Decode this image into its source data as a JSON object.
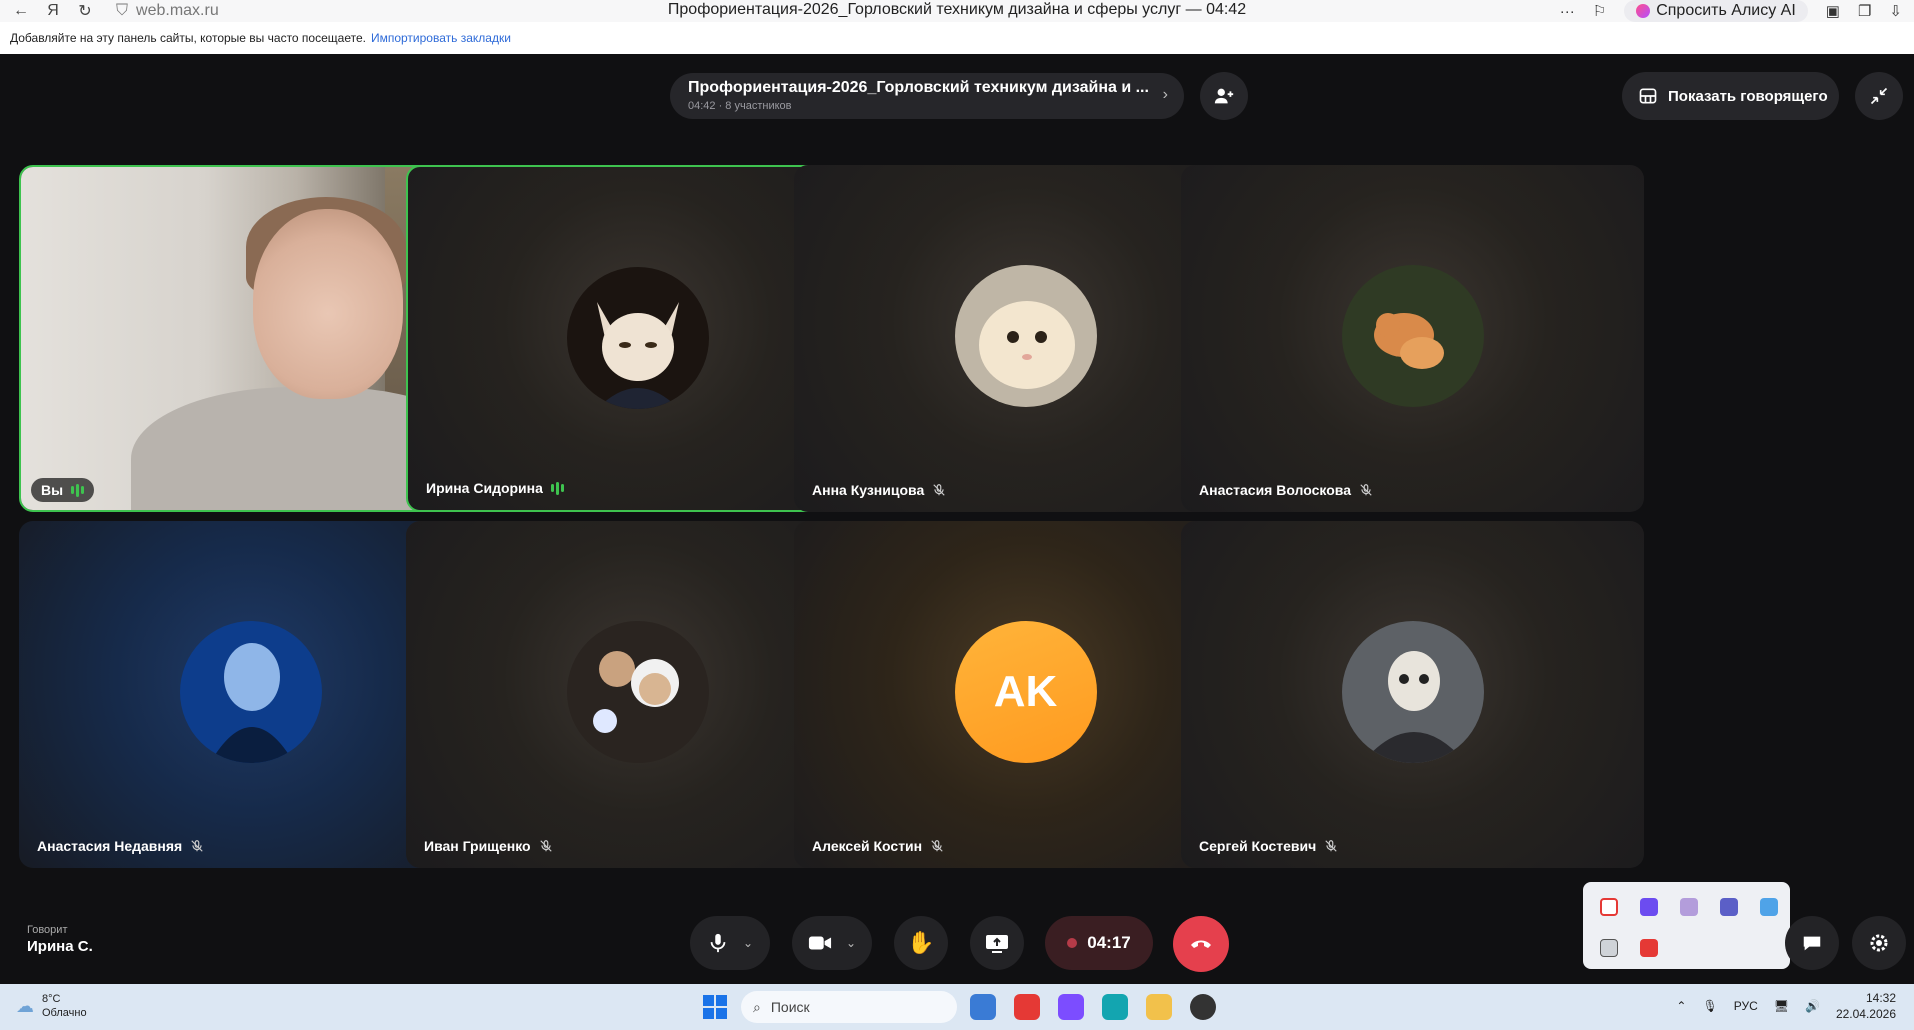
{
  "browser": {
    "url": "web.max.ru",
    "tab_title": "Профориентация-2026_Горловский техникум дизайна и сферы услуг — 04:42",
    "alisa_label": "Спросить Алису AI",
    "bookmarks_hint": "Добавляйте на эту панель сайты, которые вы часто посещаете.",
    "import_bookmarks": "Импортировать закладки"
  },
  "call": {
    "title": "Профориентация-2026_Горловский техникум дизайна и ...",
    "subtitle": "04:42 · 8 участников",
    "show_speaker": "Показать говорящего",
    "timer": "04:17",
    "speaking_label": "Говорит",
    "speaking_name": "Ирина С."
  },
  "participants": [
    {
      "name": "Вы",
      "speaking": true,
      "muted": false
    },
    {
      "name": "Ирина Сидорина",
      "speaking": true,
      "muted": false
    },
    {
      "name": "Анна Кузницова",
      "speaking": false,
      "muted": true
    },
    {
      "name": "Анастасия Волоскова",
      "speaking": false,
      "muted": true
    },
    {
      "name": "Анастасия Недавняя",
      "speaking": false,
      "muted": true
    },
    {
      "name": "Иван Грищенко",
      "speaking": false,
      "muted": true
    },
    {
      "name": "Алексей Костин",
      "speaking": false,
      "muted": true,
      "initials": "AK"
    },
    {
      "name": "Сергей Костевич",
      "speaking": false,
      "muted": true
    }
  ],
  "taskbar": {
    "temperature": "8°C",
    "weather": "Облачно",
    "search_placeholder": "Поиск",
    "lang": "РУС",
    "time": "14:32",
    "date": "22.04.2026"
  },
  "colors": {
    "speaking_border": "#3ec34f",
    "end_call": "#e5404d",
    "avatar_orange": "#ff9a1f"
  }
}
